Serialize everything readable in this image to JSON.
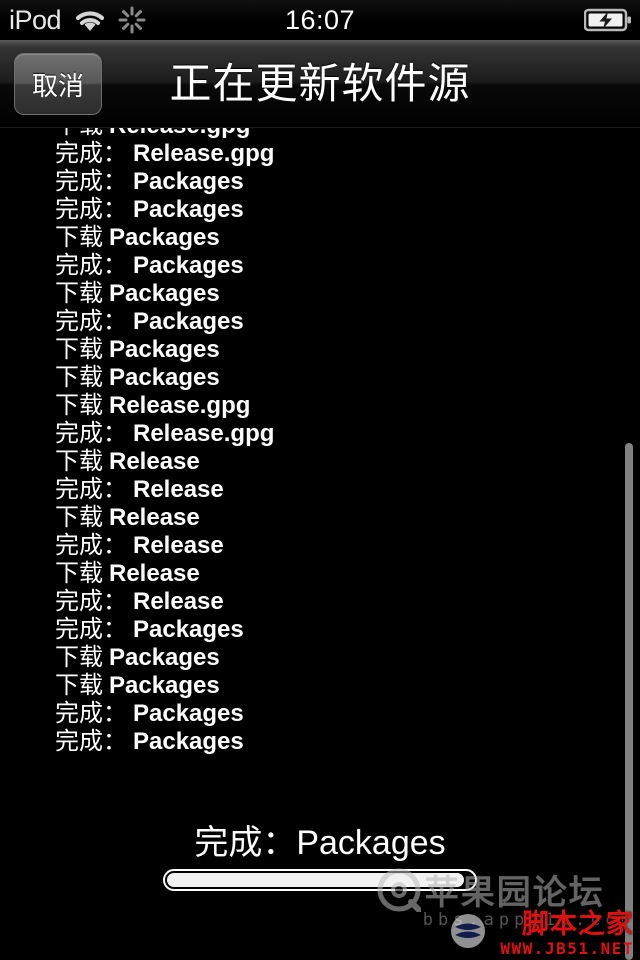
{
  "statusbar": {
    "carrier": "iPod",
    "time": "16:07",
    "wifi_icon": "wifi-icon",
    "activity_icon": "network-activity-spinner-icon",
    "battery_icon": "battery-charging-icon"
  },
  "navbar": {
    "cancel_label": "取消",
    "title": "正在更新软件源"
  },
  "log": {
    "lines": [
      {
        "verb": "下载",
        "file": "Release.gpg"
      },
      {
        "verb": "完成：",
        "file": "Release.gpg"
      },
      {
        "verb": "完成：",
        "file": "Packages"
      },
      {
        "verb": "完成：",
        "file": "Packages"
      },
      {
        "verb": "下载",
        "file": "Packages"
      },
      {
        "verb": "完成：",
        "file": "Packages"
      },
      {
        "verb": "下载",
        "file": "Packages"
      },
      {
        "verb": "完成：",
        "file": "Packages"
      },
      {
        "verb": "下载",
        "file": "Packages"
      },
      {
        "verb": "下载",
        "file": "Packages"
      },
      {
        "verb": "下载",
        "file": "Release.gpg"
      },
      {
        "verb": "完成：",
        "file": "Release.gpg"
      },
      {
        "verb": "下载",
        "file": "Release"
      },
      {
        "verb": "完成：",
        "file": "Release"
      },
      {
        "verb": "下载",
        "file": "Release"
      },
      {
        "verb": "完成：",
        "file": "Release"
      },
      {
        "verb": "下载",
        "file": "Release"
      },
      {
        "verb": "完成：",
        "file": "Release"
      },
      {
        "verb": "完成：",
        "file": "Packages"
      },
      {
        "verb": "下载",
        "file": "Packages"
      },
      {
        "verb": "下载",
        "file": "Packages"
      },
      {
        "verb": "完成：",
        "file": "Packages"
      },
      {
        "verb": "完成：",
        "file": "Packages"
      }
    ]
  },
  "footer": {
    "status_text": "完成：Packages",
    "progress_percent": 97
  },
  "watermarks": {
    "forum_name": "苹果园论坛",
    "forum_url": "bbs.app111.com",
    "jb51_name": "脚本之家",
    "jb51_url": "WWW.JB51.NET"
  },
  "colors": {
    "background": "#000000",
    "text": "#ffffff",
    "scrollbar": "#808080",
    "jb51_red": "#e01010"
  }
}
